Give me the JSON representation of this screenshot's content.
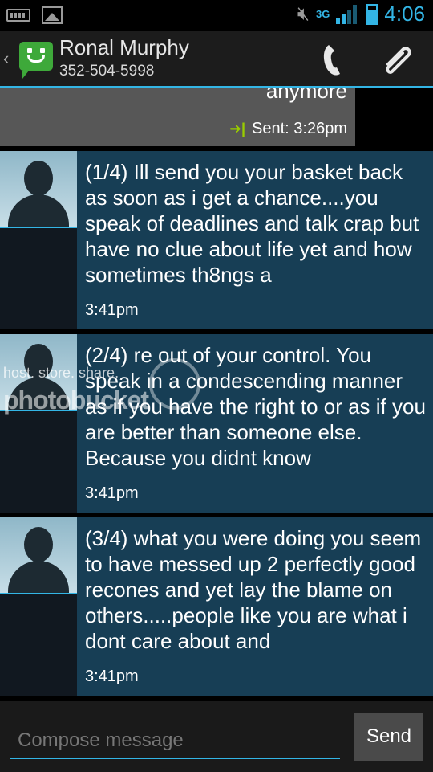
{
  "status_bar": {
    "icons": [
      "keyboard-icon",
      "picture-icon",
      "mute-icon",
      "signal-icon",
      "battery-icon"
    ],
    "network": "3G",
    "time": "4:06"
  },
  "header": {
    "contact_name": "Ronal Murphy",
    "contact_number": "352-504-5998",
    "icons": [
      "messaging-app-icon",
      "call-icon",
      "attach-icon"
    ]
  },
  "sent_message": {
    "text_tail": "anymore",
    "status": "Sent: 3:26pm"
  },
  "messages": [
    {
      "text": "(1/4) Ill send you your basket back as soon as i get a chance....you speak of deadlines and talk crap but have no clue about life yet and how sometimes th8ngs a",
      "time": "3:41pm"
    },
    {
      "text": "(2/4) re out of your control. You speak in a condescending manner as if you have the right to or as if you are better than someone else. Because you didnt know",
      "time": "3:41pm"
    },
    {
      "text": "(3/4) what you were doing you seem to have messed up 2 perfectly good recones and yet lay the blame on others.....people like you are what i dont care about and",
      "time": "3:41pm"
    }
  ],
  "watermark": {
    "line1": "host. store. share.",
    "line2": "photobucket"
  },
  "compose": {
    "placeholder": "Compose message",
    "send_label": "Send"
  },
  "colors": {
    "accent": "#33b5e5",
    "incoming_bubble": "#173e55",
    "sent_bubble": "#575757",
    "app_icon": "#3ea93a"
  }
}
